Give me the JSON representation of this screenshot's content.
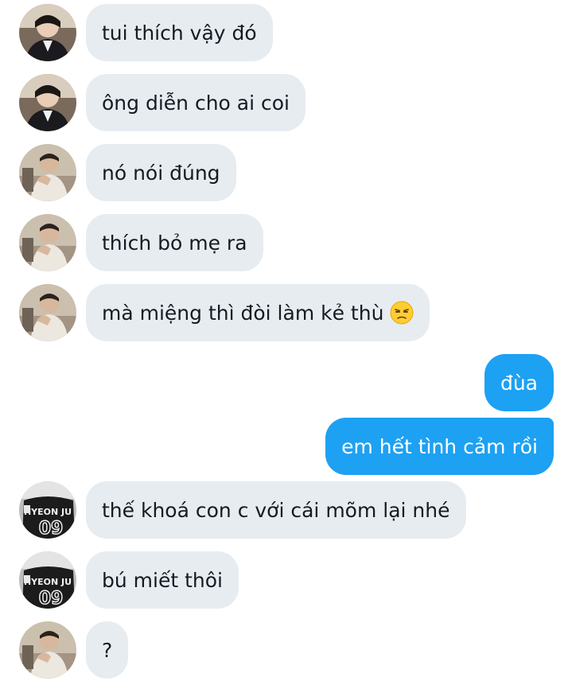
{
  "conversation": {
    "messages": [
      {
        "sender": "other",
        "avatar": "avatar-a",
        "text": "tui thích vậy đó"
      },
      {
        "sender": "other",
        "avatar": "avatar-a",
        "text": "ông diễn cho ai coi"
      },
      {
        "sender": "other",
        "avatar": "avatar-b",
        "text": "nó nói đúng"
      },
      {
        "sender": "other",
        "avatar": "avatar-b",
        "text": "thích bỏ mẹ ra"
      },
      {
        "sender": "other",
        "avatar": "avatar-b",
        "text": "mà miệng thì đòi làm kẻ thù",
        "emoji": "unamused-face-icon"
      },
      {
        "sender": "me",
        "text": "đùa"
      },
      {
        "sender": "me",
        "text": "em hết tình cảm rồi"
      },
      {
        "sender": "other",
        "avatar": "avatar-c",
        "text": "thế khoá con c với cái mõm lại nhé"
      },
      {
        "sender": "other",
        "avatar": "avatar-c",
        "text": "bú miết thôi"
      },
      {
        "sender": "other",
        "avatar": "avatar-b",
        "text": "?"
      }
    ]
  },
  "colors": {
    "incoming_bubble": "#e7ecf1",
    "outgoing_bubble": "#1da1f2",
    "incoming_text": "#141b22",
    "outgoing_text": "#ffffff"
  }
}
